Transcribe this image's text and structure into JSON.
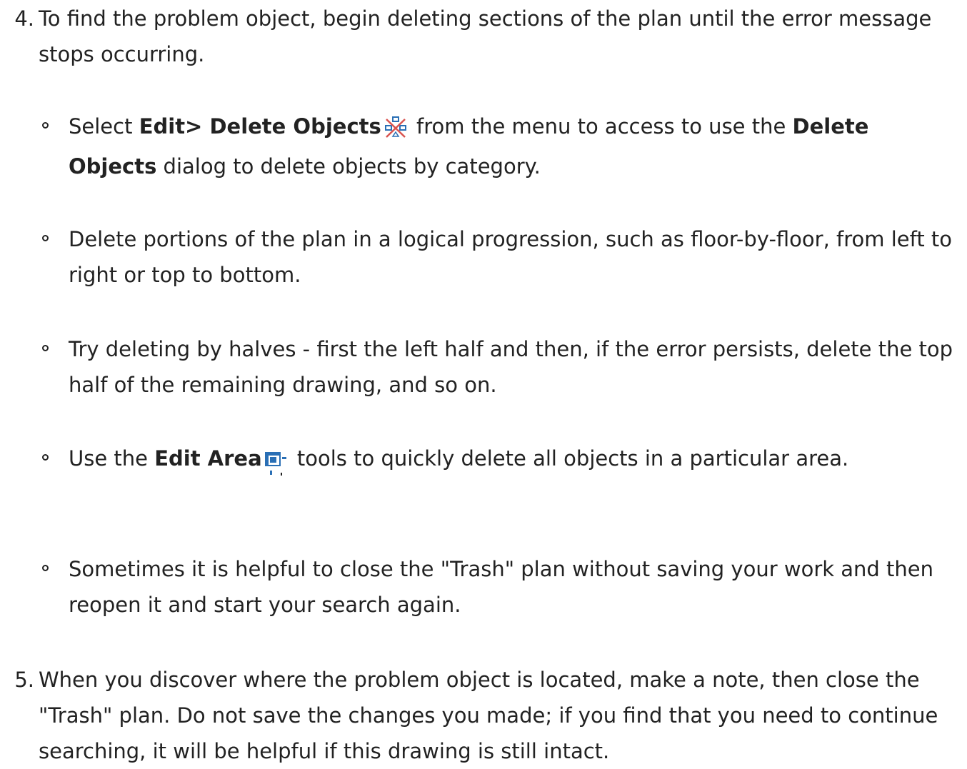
{
  "steps": [
    {
      "number": "4.",
      "text": "To find the problem object, begin deleting sections of the plan until the error message stops occurring."
    },
    {
      "number": "5.",
      "text": "When you discover where the problem object is located, make a note, then close the \"Trash\" plan. Do not save the changes you made; if you find that you need to continue searching, it will be helpful if this drawing is still intact."
    }
  ],
  "bullets": [
    {
      "pre": "Select ",
      "bold1": "Edit> Delete Objects",
      "icon": "delete-objects-icon",
      "mid": " from the menu to access to use the ",
      "bold2": "Delete Objects",
      "post": " dialog to delete objects by category."
    },
    {
      "text": "Delete portions of the plan in a logical progression, such as floor-by-floor, from left to right or top to bottom."
    },
    {
      "text": "Try deleting by halves - first the left half and then, if the error persists, delete the top half of the remaining drawing, and so on."
    },
    {
      "pre": "Use the ",
      "bold1": "Edit Area",
      "icon": "edit-area-icon",
      "post": " tools to quickly delete all objects in a particular area."
    },
    {
      "text": "Sometimes it is helpful to close the \"Trash\" plan without saving your work and then reopen it and start your search again."
    }
  ],
  "colors": {
    "text": "#222222",
    "icon_blue": "#2a6fb5",
    "icon_red": "#d9534f"
  }
}
